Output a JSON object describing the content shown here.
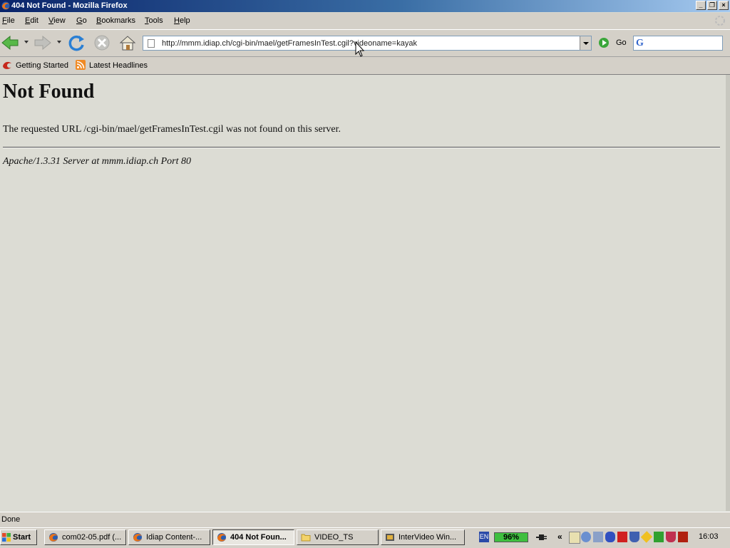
{
  "window": {
    "title": "404 Not Found - Mozilla Firefox"
  },
  "menu": {
    "items": [
      {
        "label": "File",
        "accel": "F",
        "rest": "ile"
      },
      {
        "label": "Edit",
        "accel": "E",
        "rest": "dit"
      },
      {
        "label": "View",
        "accel": "V",
        "rest": "iew"
      },
      {
        "label": "Go",
        "accel": "G",
        "rest": "o"
      },
      {
        "label": "Bookmarks",
        "accel": "B",
        "rest": "ookmarks"
      },
      {
        "label": "Tools",
        "accel": "T",
        "rest": "ools"
      },
      {
        "label": "Help",
        "accel": "H",
        "rest": "elp"
      }
    ]
  },
  "navigation": {
    "url": "http://mmm.idiap.ch/cgi-bin/mael/getFramesInTest.cgil?videoname=kayak",
    "go_label": "Go",
    "search_value": ""
  },
  "bookmarks": {
    "items": [
      {
        "label": "Getting Started",
        "icon": "firefox-red-icon"
      },
      {
        "label": "Latest Headlines",
        "icon": "rss-feed-icon"
      }
    ]
  },
  "page": {
    "heading": "Not Found",
    "message": "The requested URL /cgi-bin/mael/getFramesInTest.cgil was not found on this server.",
    "server": "Apache/1.3.31 Server at mmm.idiap.ch Port 80"
  },
  "status": {
    "text": "Done"
  },
  "taskbar": {
    "start_label": "Start",
    "tasks": [
      {
        "label": "com02-05.pdf (...",
        "icon": "firefox-icon",
        "active": false
      },
      {
        "label": "Idiap Content-...",
        "icon": "firefox-icon",
        "active": false
      },
      {
        "label": "404 Not Foun...",
        "icon": "firefox-icon",
        "active": true
      },
      {
        "label": "VIDEO_TS",
        "icon": "folder-icon",
        "active": false
      },
      {
        "label": "InterVideo Win...",
        "icon": "intervideo-icon",
        "active": false
      }
    ],
    "tray": {
      "language": "EN",
      "battery": "96%",
      "clock": "16:03"
    }
  },
  "colors": {
    "title_gradient_start": "#0a246a",
    "title_gradient_end": "#a6caf0",
    "chrome": "#d4d0c8",
    "content_bg": "#dcdcd4",
    "battery_green": "#3fbf3f"
  }
}
